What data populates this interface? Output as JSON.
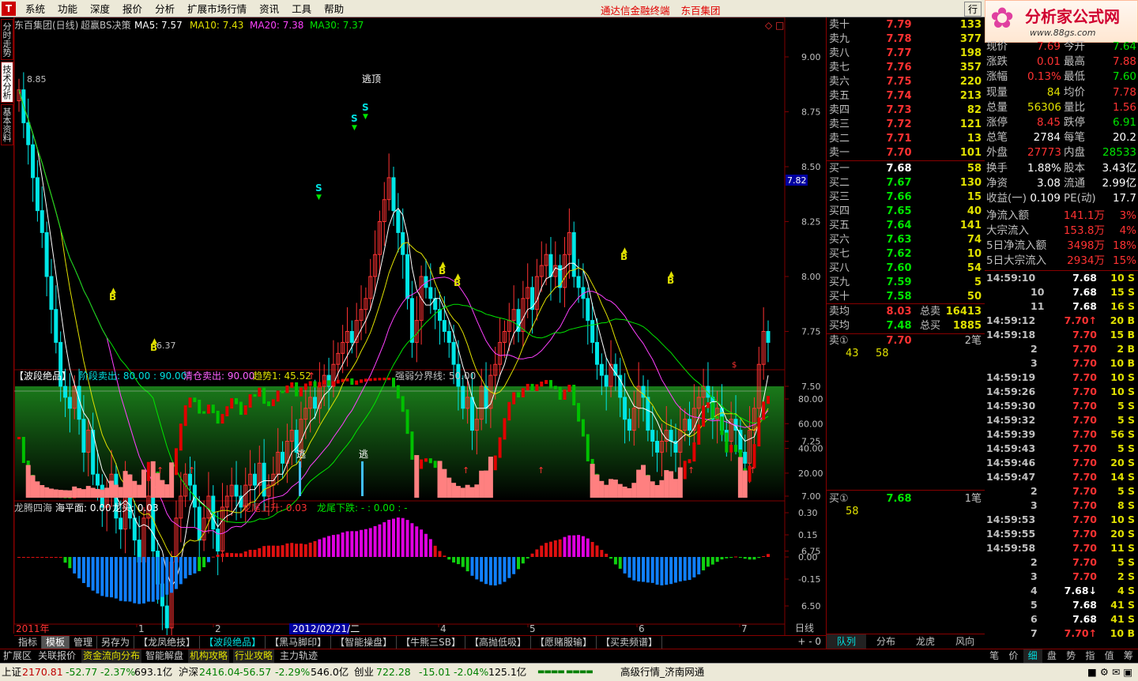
{
  "menu": {
    "items": [
      "系统",
      "功能",
      "深度",
      "报价",
      "分析",
      "扩展市场行情",
      "资讯",
      "工具",
      "帮助"
    ],
    "center": [
      "通达信金融终端",
      "东百集团"
    ],
    "right": "行"
  },
  "watermark": {
    "title": "分析家公式网",
    "url": "www.88gs.com",
    "code": "600693"
  },
  "side_tabs": [
    "分时走势",
    "技术分析",
    "基本资料"
  ],
  "main": {
    "title": "东百集团(日线)",
    "indicator": "超赢BS决策",
    "ma5": "MA5: 7.57",
    "ma10": "MA10: 7.43",
    "ma20": "MA20: 7.38",
    "ma30": "MA30: 7.37",
    "y_ticks": [
      "9.00",
      "8.75",
      "8.50",
      "8.25",
      "8.00",
      "7.75",
      "7.50",
      "7.25",
      "7.00",
      "6.75",
      "6.50"
    ],
    "current": "7.82",
    "high": "8.85",
    "low": "6.37",
    "escape_top": "逃顶",
    "s": "S",
    "b": "B"
  },
  "sub1": {
    "title": "【波段绝品】",
    "stage_sell": "阶段卖出: 80.00 : 90.00",
    "clear_sell": "清仓卖出: 90.00",
    "trend": "趋势1: 45.52",
    "trend_arrow": "↑",
    "boundary": "强弱分界线: 50.00",
    "y_ticks": [
      "80.00",
      "60.00",
      "40.00",
      "20.00"
    ],
    "escape": "逃"
  },
  "sub2": {
    "title": "龙腾四海",
    "sea": "海平面: 0.00",
    "head": "龙头: 0.03",
    "rise": "龙尾上升: 0.03",
    "fall": "龙尾下跌: - : 0.00 : -",
    "y_ticks": [
      "0.30",
      "0.15",
      "0.00",
      "-0.15"
    ]
  },
  "xaxis": {
    "year": "2011年",
    "labels": [
      "1",
      "2",
      "2012/02/21/二",
      "4",
      "5",
      "6",
      "7"
    ],
    "period": "日线"
  },
  "bottom_tabs": [
    "指标",
    "模板",
    "管理",
    "另存为",
    "【龙凤绝技】",
    "【波段绝品】",
    "【黑马脚印】",
    "【智能操盘】",
    "【牛熊三SB】",
    "【高抛低吸】",
    "【愿赌服输】",
    "【买卖频谱】"
  ],
  "sell_orders": [
    {
      "label": "卖十",
      "price": "7.79",
      "vol": "133"
    },
    {
      "label": "卖九",
      "price": "7.78",
      "vol": "377"
    },
    {
      "label": "卖八",
      "price": "7.77",
      "vol": "198"
    },
    {
      "label": "卖七",
      "price": "7.76",
      "vol": "357"
    },
    {
      "label": "卖六",
      "price": "7.75",
      "vol": "220"
    },
    {
      "label": "卖五",
      "price": "7.74",
      "vol": "213"
    },
    {
      "label": "卖四",
      "price": "7.73",
      "vol": "82"
    },
    {
      "label": "卖三",
      "price": "7.72",
      "vol": "121"
    },
    {
      "label": "卖二",
      "price": "7.71",
      "vol": "13"
    },
    {
      "label": "卖一",
      "price": "7.70",
      "vol": "101"
    }
  ],
  "buy_orders": [
    {
      "label": "买一",
      "price": "7.68",
      "vol": "58"
    },
    {
      "label": "买二",
      "price": "7.67",
      "vol": "130"
    },
    {
      "label": "买三",
      "price": "7.66",
      "vol": "15"
    },
    {
      "label": "买四",
      "price": "7.65",
      "vol": "40"
    },
    {
      "label": "买五",
      "price": "7.64",
      "vol": "141"
    },
    {
      "label": "买六",
      "price": "7.63",
      "vol": "74"
    },
    {
      "label": "买七",
      "price": "7.62",
      "vol": "10"
    },
    {
      "label": "买八",
      "price": "7.60",
      "vol": "54"
    },
    {
      "label": "买九",
      "price": "7.59",
      "vol": "5"
    },
    {
      "label": "买十",
      "price": "7.58",
      "vol": "50"
    }
  ],
  "avg": {
    "sell_avg_label": "卖均",
    "sell_avg": "8.03",
    "total_sell_label": "总卖",
    "total_sell": "16413",
    "buy_avg_label": "买均",
    "buy_avg": "7.48",
    "total_buy_label": "总买",
    "total_buy": "1885"
  },
  "queue": {
    "sell1_label": "卖①",
    "sell1_price": "7.70",
    "sell1_count": "2笔",
    "sell1_v1": "43",
    "sell1_v2": "58",
    "buy1_label": "买①",
    "buy1_price": "7.68",
    "buy1_count": "1笔",
    "buy1_v1": "58"
  },
  "info": [
    {
      "a": "现价",
      "av": "7.69",
      "b": "今开",
      "bv": "7.64",
      "avc": "red",
      "bvc": "green"
    },
    {
      "a": "涨跌",
      "av": "0.01",
      "b": "最高",
      "bv": "7.88",
      "avc": "red",
      "bvc": "red"
    },
    {
      "a": "涨幅",
      "av": "0.13%",
      "b": "最低",
      "bv": "7.60",
      "avc": "red",
      "bvc": "green"
    },
    {
      "a": "现量",
      "av": "84",
      "b": "均价",
      "bv": "7.78",
      "avc": "yellow",
      "bvc": "red"
    },
    {
      "a": "总量",
      "av": "56306",
      "b": "量比",
      "bv": "1.56",
      "avc": "yellow",
      "bvc": "red"
    },
    {
      "a": "涨停",
      "av": "8.45",
      "b": "跌停",
      "bv": "6.91",
      "avc": "red",
      "bvc": "green"
    },
    {
      "a": "总笔",
      "av": "2784",
      "b": "每笔",
      "bv": "20.2",
      "avc": "white",
      "bvc": "white"
    },
    {
      "a": "外盘",
      "av": "27773",
      "b": "内盘",
      "bv": "28533",
      "avc": "red",
      "bvc": "green"
    },
    {
      "a": "换手",
      "av": "1.88%",
      "b": "股本",
      "bv": "3.43亿",
      "avc": "white",
      "bvc": "white"
    },
    {
      "a": "净资",
      "av": "3.08",
      "b": "流通",
      "bv": "2.99亿",
      "avc": "white",
      "bvc": "white"
    },
    {
      "a": "收益(一)",
      "av": "0.109",
      "b": "PE(动)",
      "bv": "17.7",
      "avc": "white",
      "bvc": "white"
    }
  ],
  "flows": [
    {
      "label": "净流入额",
      "val": "141.1万",
      "pct": "3%"
    },
    {
      "label": "大宗流入",
      "val": "153.8万",
      "pct": "4%"
    },
    {
      "label": "5日净流入额",
      "val": "3498万",
      "pct": "18%"
    },
    {
      "label": "5日大宗流入",
      "val": "2934万",
      "pct": "15%"
    }
  ],
  "ticks": [
    {
      "t": "14:59:10",
      "p": "7.68",
      "v": "10 S",
      "c": "white"
    },
    {
      "t": "10",
      "p": "7.68",
      "v": "15 S",
      "c": "white"
    },
    {
      "t": "11",
      "p": "7.68",
      "v": "16 S",
      "c": "white"
    },
    {
      "t": "14:59:12",
      "p": "7.70↑",
      "v": "20 B",
      "c": "red"
    },
    {
      "t": "14:59:18",
      "p": "7.70",
      "v": "15 B",
      "c": "red"
    },
    {
      "t": "2",
      "p": "7.70",
      "v": "2 B",
      "c": "red"
    },
    {
      "t": "3",
      "p": "7.70",
      "v": "10 B",
      "c": "red"
    },
    {
      "t": "14:59:19",
      "p": "7.70",
      "v": "10 S",
      "c": "red"
    },
    {
      "t": "14:59:26",
      "p": "7.70",
      "v": "10 S",
      "c": "red"
    },
    {
      "t": "14:59:30",
      "p": "7.70",
      "v": "5 S",
      "c": "red"
    },
    {
      "t": "14:59:32",
      "p": "7.70",
      "v": "5 S",
      "c": "red"
    },
    {
      "t": "14:59:39",
      "p": "7.70",
      "v": "56 S",
      "c": "red"
    },
    {
      "t": "14:59:43",
      "p": "7.70",
      "v": "5 S",
      "c": "red"
    },
    {
      "t": "14:59:46",
      "p": "7.70",
      "v": "20 S",
      "c": "red"
    },
    {
      "t": "14:59:47",
      "p": "7.70",
      "v": "14 S",
      "c": "red"
    },
    {
      "t": "2",
      "p": "7.70",
      "v": "5 S",
      "c": "red"
    },
    {
      "t": "3",
      "p": "7.70",
      "v": "8 S",
      "c": "red"
    },
    {
      "t": "14:59:53",
      "p": "7.70",
      "v": "10 S",
      "c": "red"
    },
    {
      "t": "14:59:55",
      "p": "7.70",
      "v": "20 S",
      "c": "red"
    },
    {
      "t": "14:59:58",
      "p": "7.70",
      "v": "11 S",
      "c": "red"
    },
    {
      "t": "2",
      "p": "7.70",
      "v": "5 S",
      "c": "red"
    },
    {
      "t": "3",
      "p": "7.70",
      "v": "2 S",
      "c": "red"
    },
    {
      "t": "4",
      "p": "7.68↓",
      "v": "4 S",
      "c": "white"
    },
    {
      "t": "5",
      "p": "7.68",
      "v": "41 S",
      "c": "white"
    },
    {
      "t": "6",
      "p": "7.68",
      "v": "41 S",
      "c": "white"
    },
    {
      "t": "7",
      "p": "7.70↑",
      "v": "10 B",
      "c": "red"
    }
  ],
  "right_bottom_tabs": [
    "队列",
    "分布",
    "龙虎",
    "风向"
  ],
  "far_right_tabs": [
    "笔",
    "价",
    "细",
    "盘",
    "势",
    "指",
    "值",
    "筹"
  ],
  "nav": [
    "扩展区",
    "关联报价",
    "资金流向分布",
    "智能解盘",
    "机构攻略",
    "行业攻略",
    "主力轨迹"
  ],
  "status": {
    "sh_label": "上证",
    "sh": "2170.81",
    "sh_chg": "-52.77",
    "sh_pct": "-2.37%",
    "sh_amt": "693.1亿",
    "hs_label": "沪深",
    "hs": "2416.04",
    "hs_chg": "-56.57",
    "hs_pct": "-2.29%",
    "hs_amt": "546.0亿",
    "cy_label": "创业",
    "cy": "722.28",
    "cy_chg": "-15.01",
    "cy_pct": "-2.04%",
    "cy_amt": "125.1亿",
    "feed": "高级行情_济南网通"
  },
  "colors": {
    "up": "#ff3232",
    "down": "#00e6e6",
    "ma5": "#ffffff",
    "ma10": "#e0e000",
    "ma20": "#ff40ff",
    "ma30": "#00e600",
    "frame": "#800000"
  }
}
